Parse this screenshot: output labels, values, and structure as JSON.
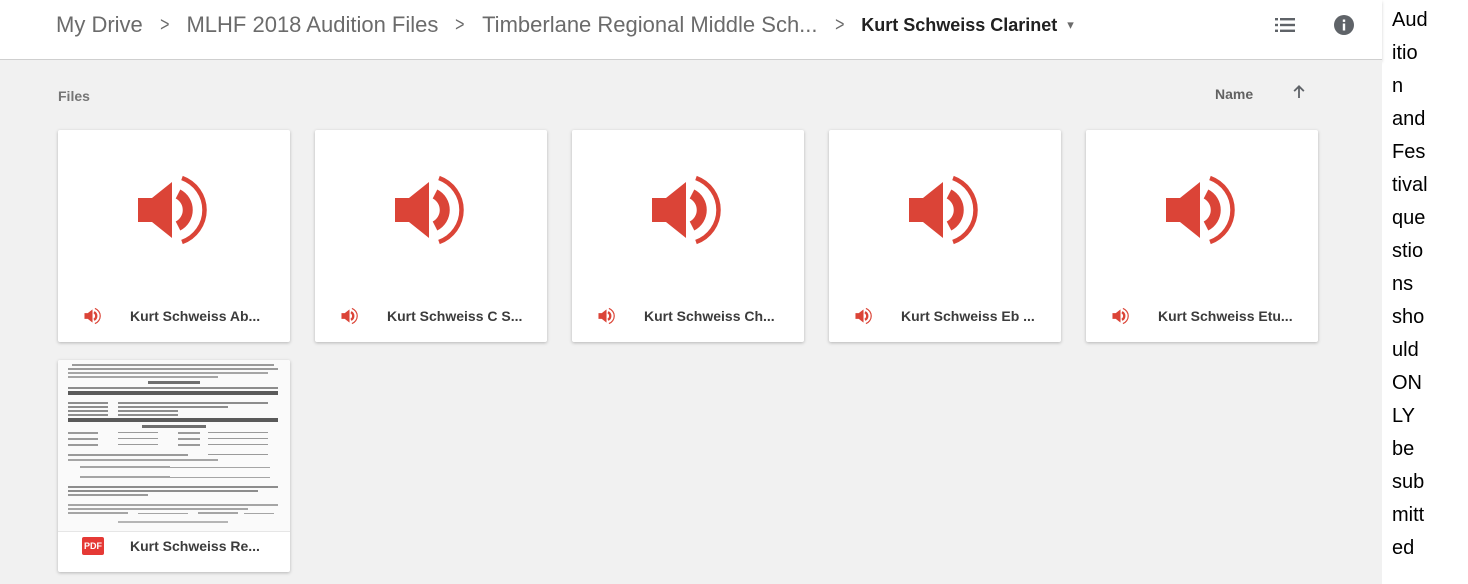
{
  "breadcrumb": {
    "items": [
      "My Drive",
      "MLHF 2018 Audition Files",
      "Timberlane Regional Middle Sch..."
    ],
    "separator": ">",
    "current": "Kurt Schweiss Clarinet",
    "caret": "▾"
  },
  "header": {
    "list_view_icon": "list-view-icon",
    "info_icon": "info-icon"
  },
  "section": {
    "label": "Files",
    "sort_label": "Name",
    "sort_icon": "arrow-up-icon"
  },
  "files": [
    {
      "name": "Kurt Schweiss Ab...",
      "type": "audio"
    },
    {
      "name": "Kurt Schweiss C S...",
      "type": "audio"
    },
    {
      "name": "Kurt Schweiss Ch...",
      "type": "audio"
    },
    {
      "name": "Kurt Schweiss Eb ...",
      "type": "audio"
    },
    {
      "name": "Kurt Schweiss Etu...",
      "type": "audio"
    },
    {
      "name": "Kurt Schweiss Re...",
      "type": "pdf",
      "badge": "PDF"
    }
  ],
  "side_text": "Aud\nitio\nn\nand\nFes\ntival\nque\nstio\nns\nsho\nuld\nON\nLY\nbe\nsub\nmitt\ned",
  "colors": {
    "audio_red": "#db4437",
    "pdf_red": "#e53935",
    "content_bg": "#f1f1f1"
  }
}
